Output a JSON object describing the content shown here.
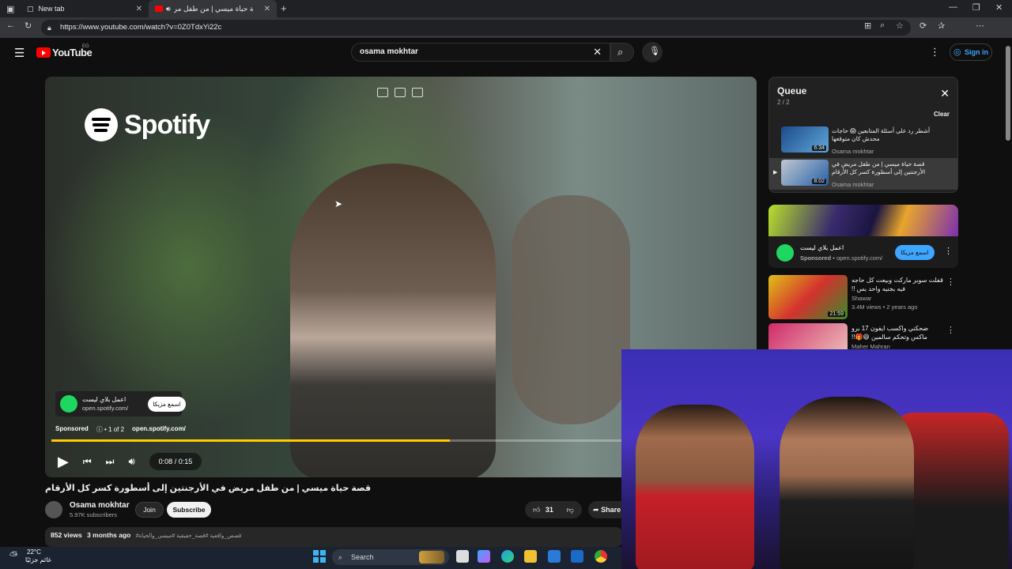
{
  "browser": {
    "tabs": [
      {
        "label": "New tab"
      },
      {
        "label": "قصة حياة ميسي | من طفل مر"
      }
    ],
    "url": "https://www.youtube.com/watch?v=0Z0TdxYi22c"
  },
  "header": {
    "logo": "YouTube",
    "region": "EG",
    "search_value": "osama mokhtar",
    "signin_label": "Sign in"
  },
  "player": {
    "brand": "Spotify",
    "ad_card": {
      "title": "اعمل بلاي ليست",
      "url": "open.spotify.com/",
      "button": "اسمع مزيكا"
    },
    "sponsored": "Sponsored",
    "ad_index": "1 of 2",
    "ad_domain": "open.spotify.com/",
    "progress_fraction": 0.57,
    "time": "0:08 / 0:15"
  },
  "video": {
    "title": "قصة حياة ميسي | من طفل مريض في الأرجنتين إلى أسطورة كسر كل الأرقام",
    "channel": "Osama mokhtar",
    "subscribers": "5.97K subscribers",
    "join_label": "Join",
    "subscribe_label": "Subscribe",
    "likes": "31",
    "share_label": "Share",
    "views": "852 views",
    "age": "3 months ago",
    "tags": "#قصص_واقعية #قصة_حقيقية #ميسي_والحياة"
  },
  "queue": {
    "title": "Queue",
    "count": "2 / 2",
    "clear_label": "Clear",
    "items": [
      {
        "title": "أشطر رد على أسئلة المتابعين 😱 حاجات محدش كان متوقعها",
        "duration": "6:34",
        "channel": "Osama mokhtar"
      },
      {
        "title": "قصة حياة ميسي | من طفل مريض في الأرجنتين إلى أسطورة كسر كل الأرقام",
        "duration": "8:02",
        "channel": "Osama mokhtar"
      }
    ]
  },
  "ad_panel": {
    "title": "اعمل بلاي ليست",
    "sponsored": "Sponsored",
    "domain": "open.spotify.com/",
    "button": "اسمع مزيكا"
  },
  "recommendations": [
    {
      "title": "قفلت سوبر ماركت وبيعت كل حاجه فيه بجنيه واحد بس !!",
      "duration": "21:59",
      "channel": "Shawar",
      "meta": "3.4M views • 2 years ago"
    },
    {
      "title": "ضحكني واكسب ايفون 17 برو ماكس وتحكم سالمين 😆🎁!!",
      "duration": "",
      "channel": "Maher Mahran",
      "meta": ""
    }
  ],
  "taskbar": {
    "temp": "22°C",
    "weather_text": "غائم جزئيًا",
    "search_label": "Search"
  }
}
